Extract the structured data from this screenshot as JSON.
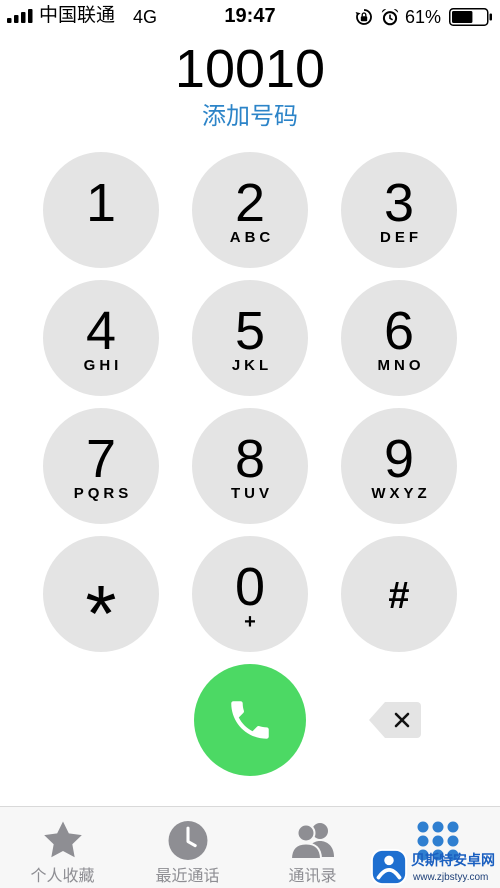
{
  "status_bar": {
    "carrier": "中国联通",
    "network": "4G",
    "time": "19:47",
    "battery_percent": "61%",
    "battery_level": 0.61,
    "signal_bars": 4,
    "icons": [
      "signal-icon",
      "rotation-lock-icon",
      "alarm-icon",
      "battery-icon"
    ]
  },
  "dialer": {
    "number": "10010",
    "add_number_label": "添加号码"
  },
  "keypad": {
    "keys": [
      {
        "digit": "1"
      },
      {
        "digit": "2",
        "letters": "ABC"
      },
      {
        "digit": "3",
        "letters": "DEF"
      },
      {
        "digit": "4",
        "letters": "GHI"
      },
      {
        "digit": "5",
        "letters": "JKL"
      },
      {
        "digit": "6",
        "letters": "MNO"
      },
      {
        "digit": "7",
        "letters": "PQRS"
      },
      {
        "digit": "8",
        "letters": "TUV"
      },
      {
        "digit": "9",
        "letters": "WXYZ"
      },
      {
        "digit": "*"
      },
      {
        "digit": "0",
        "letters": "+"
      },
      {
        "digit": "#"
      }
    ]
  },
  "actions": {
    "call_icon": "phone-icon",
    "delete_icon": "backspace-icon"
  },
  "tab_bar": {
    "tabs": [
      {
        "label": "个人收藏",
        "icon": "star-icon"
      },
      {
        "label": "最近通话",
        "icon": "clock-icon"
      },
      {
        "label": "通讯录",
        "icon": "contacts-icon"
      },
      {
        "icon": "keypad-icon",
        "active": true
      }
    ]
  },
  "watermark": {
    "name": "贝斯特安卓网",
    "url": "www.zjbstyy.com",
    "icon": "watermark-logo-icon"
  },
  "colors": {
    "accent": "#2c84c8",
    "call_green": "#4cd964",
    "key_background": "#e4e4e4",
    "tab_active": "#2f7fd0",
    "tab_inactive": "#8e8e93"
  }
}
